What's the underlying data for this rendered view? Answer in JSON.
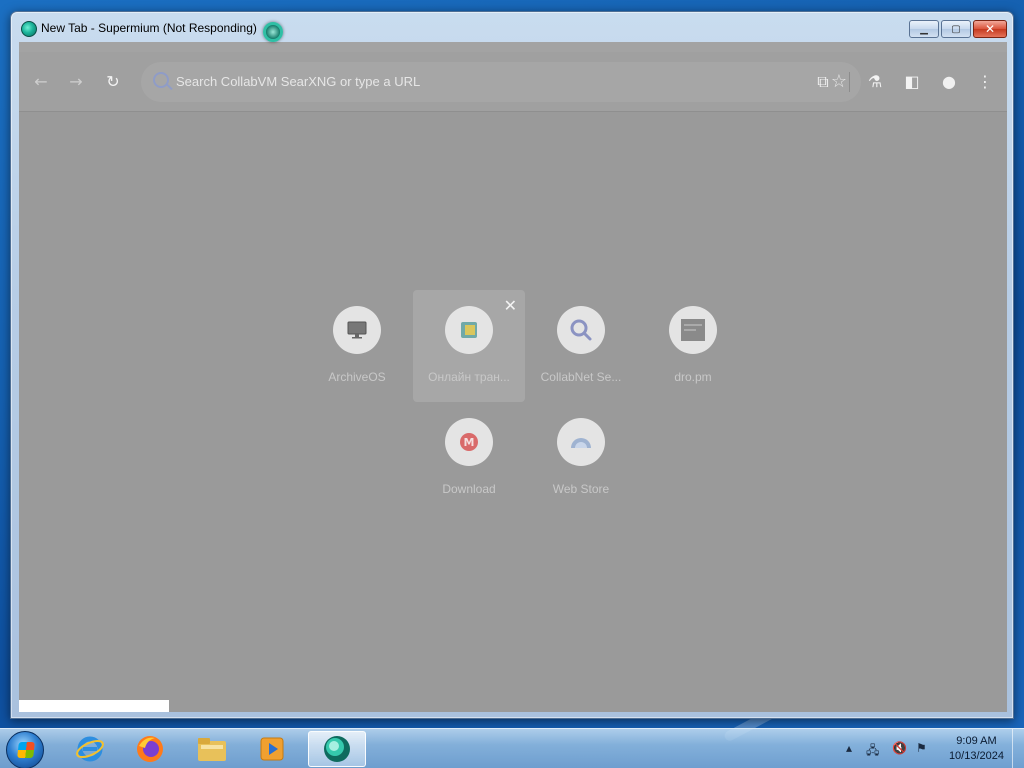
{
  "window": {
    "title": "New Tab - Supermium (Not Responding)",
    "controls": [
      "minimize",
      "maximize",
      "close"
    ]
  },
  "toolbar": {
    "back_icon": "back-arrow-icon",
    "forward_icon": "forward-arrow-icon",
    "reload_icon": "reload-icon",
    "omnibox_placeholder": "Search CollabVM SearXNG or type a URL",
    "right_icons": [
      "star-icon",
      "extensions-icon",
      "labs-icon",
      "side-panel-icon",
      "profile-icon",
      "menu-icon"
    ]
  },
  "shortcuts": [
    {
      "label": "ArchiveOS",
      "icon": "monitor-icon"
    },
    {
      "label": "Онлайн тран...",
      "icon": "folder-icon"
    },
    {
      "label": "CollabNet Se...",
      "icon": "search-icon"
    },
    {
      "label": "dro.pm",
      "icon": "thumbnail-icon"
    },
    {
      "label": "Download",
      "icon": "mega-icon"
    },
    {
      "label": "Web Store",
      "icon": "webstore-icon"
    }
  ],
  "taskbar": {
    "apps": [
      "start-button",
      "internet-explorer",
      "firefox",
      "file-explorer",
      "media-player",
      "supermium"
    ],
    "time": "9:09 AM",
    "date": "10/13/2024"
  },
  "colors": {
    "dimmed_client": "#9a9a9a",
    "desktop": "#1560b0"
  }
}
